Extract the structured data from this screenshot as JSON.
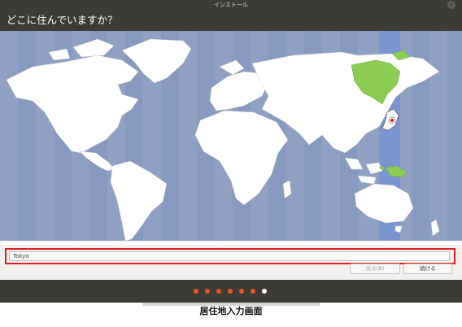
{
  "window": {
    "title": "インストール",
    "close_glyph": "×"
  },
  "page": {
    "heading": "どこに住んでいますか？"
  },
  "location": {
    "value": "Tokyo",
    "selected_city": "Tokyo"
  },
  "buttons": {
    "back_label": "戻る(B)",
    "continue_label": "続ける"
  },
  "progress": {
    "total_steps": 7,
    "current_step": 7,
    "done_color": "#e95420",
    "current_color": "#ffffff"
  },
  "caption": "居住地入力画面",
  "colors": {
    "ocean": "#8fa0c2",
    "land": "#ffffff",
    "selected_zone": "#7a95cf",
    "highlight_region": "#8ccc52",
    "window_bg": "#3c3b37",
    "annotation_box": "#e02020"
  }
}
